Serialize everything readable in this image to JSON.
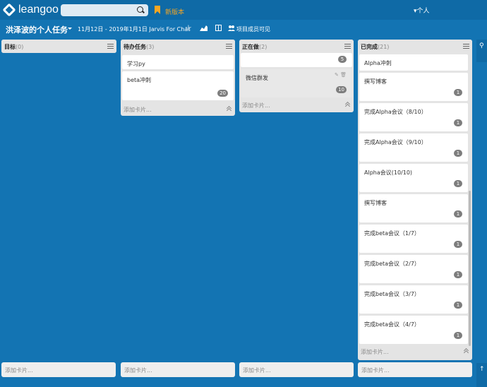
{
  "app": {
    "brand": "leangoo",
    "new_version": "新版本",
    "user_menu": "▾个人"
  },
  "search": {
    "placeholder": ""
  },
  "board": {
    "title": "洪泽波的个人任务",
    "dates": "11月12日 - 2019年1月1日 Jarvis For Chat",
    "visibility": "项目成员可见"
  },
  "lists": [
    {
      "title": "目标",
      "count": "(0)",
      "cards": [],
      "add_label": ""
    },
    {
      "title": "待办任务",
      "count": "(3)",
      "cards": [
        {
          "title": "学习py",
          "badge": ""
        },
        {
          "title": "beta冲刺",
          "badge": "20"
        }
      ],
      "add_label": "添加卡片..."
    },
    {
      "title": "正在做",
      "count": "(2)",
      "cards": [
        {
          "title": "",
          "badge": "5"
        },
        {
          "title": "微信群发",
          "badge": "10"
        }
      ],
      "add_label": "添加卡片..."
    },
    {
      "title": "已完成",
      "count": "(21)",
      "cards": [
        {
          "title": "Alpha冲刺",
          "badge": ""
        },
        {
          "title": "撰写博客",
          "badge": "1"
        },
        {
          "title": "完成Alpha会议（8/10）",
          "badge": "1"
        },
        {
          "title": "完成Alpha会议（9/10）",
          "badge": "1"
        },
        {
          "title": "Alpha会议(10/10)",
          "badge": "1"
        },
        {
          "title": "撰写博客",
          "badge": "1"
        },
        {
          "title": "完成beta会议（1/7）",
          "badge": "1"
        },
        {
          "title": "完成beta会议（2/7）",
          "badge": "1"
        },
        {
          "title": "完成beta会议（3/7）",
          "badge": "1"
        },
        {
          "title": "完成beta会议（4/7）",
          "badge": "1"
        }
      ],
      "add_label": "添加卡片..."
    }
  ],
  "bottom_add": [
    "添加卡片...",
    "添加卡片...",
    "添加卡片...",
    "添加卡片..."
  ],
  "icons": [
    "logo-icon",
    "search-icon",
    "bookmark-icon",
    "star-icon",
    "chart-icon",
    "layout-icon",
    "members-icon",
    "list-menu-icon",
    "collapse-icon",
    "edit-icon",
    "delete-icon"
  ],
  "colors": {
    "background": "#1374b3",
    "topbar": "#0f6aa6",
    "accent": "#f5a623",
    "badge": "#7d7d7d"
  }
}
